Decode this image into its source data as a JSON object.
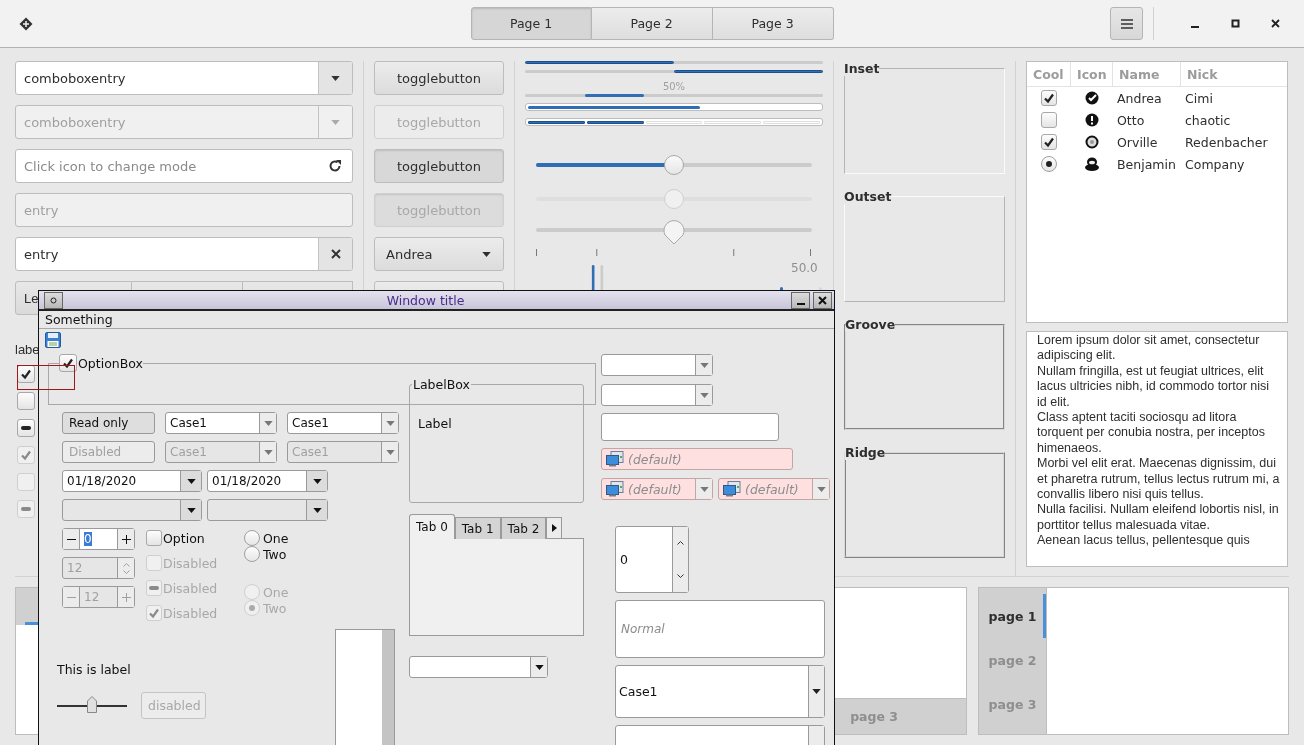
{
  "header": {
    "tabs": [
      {
        "label": "Page 1",
        "selected": true
      },
      {
        "label": "Page 2",
        "selected": false
      },
      {
        "label": "Page 3",
        "selected": false
      }
    ]
  },
  "entries": [
    {
      "kind": "combo",
      "value": "comboboxentry",
      "disabled": false
    },
    {
      "kind": "combo",
      "value": "comboboxentry",
      "disabled": true
    },
    {
      "kind": "icon",
      "placeholder": "Click icon to change mode",
      "disabled": false
    },
    {
      "kind": "plain",
      "value": "entry",
      "disabled": true
    },
    {
      "kind": "clear",
      "value": "entry",
      "disabled": false
    }
  ],
  "linked_buttons": [
    "Le"
  ],
  "label_text": "labe",
  "checks": [
    {
      "checked": true,
      "disabled": false
    },
    {
      "checked": false,
      "disabled": false
    },
    {
      "mixed": true,
      "disabled": false
    },
    {
      "checked": true,
      "disabled": true
    },
    {
      "checked": false,
      "disabled": true
    },
    {
      "mixed": true,
      "disabled": true
    }
  ],
  "toggles": [
    {
      "label": "togglebutton",
      "on": false,
      "disabled": false
    },
    {
      "label": "togglebutton",
      "on": false,
      "disabled": true
    },
    {
      "label": "togglebutton",
      "on": true,
      "disabled": false
    },
    {
      "label": "togglebutton",
      "on": true,
      "disabled": true
    }
  ],
  "combo": {
    "value": "Andrea"
  },
  "progress": [
    {
      "kind": "normal",
      "level": 0.5
    },
    {
      "kind": "inverted",
      "level": 0.5
    },
    {
      "kind": "pulse",
      "text": "50%",
      "level": 0.2
    },
    {
      "kind": "boxed",
      "level": 0.59
    },
    {
      "kind": "segmented",
      "level": 0.4
    }
  ],
  "scales": [
    {
      "kind": "filled",
      "level": 0.5
    },
    {
      "kind": "plain",
      "level": 0.5
    },
    {
      "kind": "marks",
      "level": 0.5
    }
  ],
  "scale_value": "50.0",
  "frames": [
    {
      "label": "Inset",
      "kind": "inset"
    },
    {
      "label": "Outset",
      "kind": "outset"
    },
    {
      "label": "Groove",
      "kind": "groove"
    },
    {
      "label": "Ridge",
      "kind": "ridge"
    }
  ],
  "tree": {
    "columns": [
      "Cool",
      "Icon",
      "Name",
      "Nick"
    ],
    "rows": [
      {
        "kind": "check",
        "checked": true,
        "name": "Andrea",
        "nick": "Cimi"
      },
      {
        "kind": "check",
        "checked": false,
        "name": "Otto",
        "nick": "chaotic"
      },
      {
        "kind": "check",
        "checked": true,
        "name": "Orville",
        "nick": "Redenbacher"
      },
      {
        "kind": "radio",
        "checked": true,
        "name": "Benjamin",
        "nick": "Company"
      }
    ]
  },
  "text_view": [
    "Lorem ipsum dolor sit amet, consectetur adipiscing elit.",
    "Nullam fringilla, est ut feugiat ultrices, elit lacus ultricies nibh, id commodo tortor nisi id elit.",
    "Class aptent taciti sociosqu ad litora torquent per conubia nostra, per inceptos himenaeos.",
    "Morbi vel elit erat. Maecenas dignissim, dui et pharetra rutrum, tellus lectus rutrum mi, a convallis libero nisi quis tellus.",
    "Nulla facilisi. Nullam eleifend lobortis nisl, in porttitor tellus malesuada vitae.",
    "Aenean lacus tellus, pellentesque quis"
  ],
  "notebook_bottom": {
    "tabs": [
      {
        "label": "page 3",
        "selected": false
      }
    ]
  },
  "notebook_side": {
    "tabs": [
      {
        "label": "page 1",
        "selected": true
      },
      {
        "label": "page 2",
        "selected": false
      },
      {
        "label": "page 3",
        "selected": false
      }
    ]
  },
  "window": {
    "title": "Window title",
    "menu": [
      "Something"
    ],
    "option_box": {
      "label": "OptionBox",
      "checked": true
    },
    "form_rows": [
      [
        {
          "kind": "entry",
          "value": "Read only",
          "readonly": true,
          "disabled": false
        },
        {
          "kind": "combo",
          "value": "Case1",
          "disabled": false
        },
        {
          "kind": "combo",
          "value": "Case1",
          "disabled": false
        }
      ],
      [
        {
          "kind": "entry",
          "value": "Disabled",
          "disabled": true
        },
        {
          "kind": "combo",
          "value": "Case1",
          "disabled": true
        },
        {
          "kind": "combo",
          "value": "Case1",
          "disabled": true
        }
      ],
      [
        {
          "kind": "date",
          "value": "01/18/2020",
          "disabled": false
        },
        {
          "kind": "date",
          "value": "01/18/2020",
          "disabled": false
        }
      ],
      [
        {
          "kind": "date",
          "disabled": true
        },
        {
          "kind": "date",
          "disabled": true
        }
      ]
    ],
    "spins": [
      {
        "kind": "buttons",
        "value": "0",
        "disabled": false,
        "value_selected": true
      },
      {
        "kind": "arrows",
        "value": "12",
        "disabled": true,
        "value_selected": false
      },
      {
        "kind": "buttons",
        "value": "12",
        "disabled": true,
        "value_selected": false
      }
    ],
    "checks": [
      {
        "label": "Option",
        "checked": false,
        "disabled": false
      },
      {
        "label": "Disabled",
        "checked": false,
        "disabled": true
      },
      {
        "label": "Disabled",
        "mixed": true,
        "disabled": true
      },
      {
        "label": "Disabled",
        "checked": true,
        "disabled": true
      }
    ],
    "radio_groups": [
      [
        {
          "label": "One",
          "selected": false,
          "disabled": false
        },
        {
          "label": "Two",
          "selected": false,
          "disabled": false
        }
      ],
      [
        {
          "label": "One",
          "selected": false,
          "disabled": true
        },
        {
          "label": "Two",
          "selected": true,
          "disabled": true
        }
      ]
    ],
    "label": "This is label",
    "slider": {
      "level": 0.5
    },
    "button": {
      "label": "disabled",
      "disabled": true
    },
    "label_box": {
      "title": "LabelBox",
      "text": "Label"
    },
    "tabs": [
      {
        "label": "Tab 0",
        "selected": true
      },
      {
        "label": "Tab 1",
        "selected": false
      },
      {
        "label": "Tab 2",
        "selected": false
      }
    ],
    "right_combos": [
      {
        "kind": "combo",
        "disabled": false
      },
      {
        "kind": "combo",
        "disabled": false
      }
    ],
    "device_fields": [
      {
        "kind": "entry",
        "placeholder": "(default)"
      },
      {
        "kind": "combo",
        "placeholder": "(default)"
      },
      {
        "kind": "combo",
        "placeholder": "(default)"
      }
    ],
    "spin": {
      "value": "0"
    },
    "entry": {
      "placeholder": "Normal"
    },
    "combo": {
      "value": "Case1"
    }
  }
}
